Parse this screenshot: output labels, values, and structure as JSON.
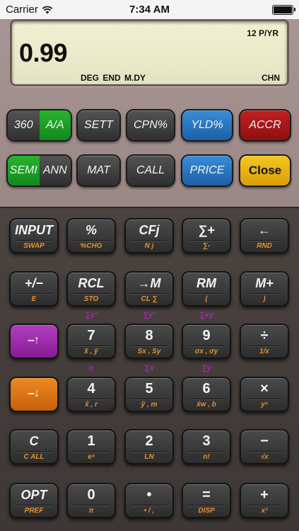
{
  "status": {
    "carrier": "Carrier",
    "time": "7:34 AM"
  },
  "display": {
    "mode": "12 P/YR",
    "value": "0.99",
    "flags": "DEG  END  M.DY",
    "right_flag": "CHN"
  },
  "function_rows": [
    [
      {
        "type": "split",
        "left": "360",
        "right": "A/A",
        "active": "right"
      },
      {
        "label": "SETT",
        "color": "dark"
      },
      {
        "label": "CPN%",
        "color": "dark"
      },
      {
        "label": "YLD%",
        "color": "blue"
      },
      {
        "label": "ACCR",
        "color": "red"
      }
    ],
    [
      {
        "type": "split",
        "left": "SEMI",
        "right": "ANN",
        "active": "left"
      },
      {
        "label": "MAT",
        "color": "dark"
      },
      {
        "label": "CALL",
        "color": "dark"
      },
      {
        "label": "PRICE",
        "color": "blue"
      },
      {
        "label": "Close",
        "color": "yellow"
      }
    ]
  ],
  "keys": [
    [
      {
        "main": "INPUT",
        "sub": "SWAP"
      },
      {
        "main": "%",
        "sub": "%CHG"
      },
      {
        "main": "CFj",
        "sub": "N j"
      },
      {
        "main": "∑+",
        "sub": "∑-"
      },
      {
        "main": "←",
        "sub": "RND"
      }
    ],
    [
      {
        "main": "+/−",
        "sub": "E"
      },
      {
        "main": "RCL",
        "sub": "STO"
      },
      {
        "main": "→M",
        "sub": "CL ∑"
      },
      {
        "main": "RM",
        "sub": "("
      },
      {
        "main": "M+",
        "sub": ")"
      }
    ],
    [
      {
        "main": "",
        "shift": "up",
        "color": "purple"
      },
      {
        "main": "7",
        "sub": "x̄ , ȳ",
        "above": "∑x²"
      },
      {
        "main": "8",
        "sub": "Sx , Sy",
        "above": "∑y²"
      },
      {
        "main": "9",
        "sub": "σx , σy",
        "above": "∑xy"
      },
      {
        "main": "÷",
        "sub": "1/x"
      }
    ],
    [
      {
        "main": "",
        "shift": "down",
        "color": "orange"
      },
      {
        "main": "4",
        "sub": "x̂ , r",
        "above": "n"
      },
      {
        "main": "5",
        "sub": "ŷ , m",
        "above": "∑x"
      },
      {
        "main": "6",
        "sub": "x̄w , b",
        "above": "∑y"
      },
      {
        "main": "×",
        "sub": "yˣ"
      }
    ],
    [
      {
        "main": "C",
        "sub": "C ALL"
      },
      {
        "main": "1",
        "sub": "eˣ"
      },
      {
        "main": "2",
        "sub": "LN"
      },
      {
        "main": "3",
        "sub": "n!"
      },
      {
        "main": "−",
        "sub": "√x"
      }
    ],
    [
      {
        "main": "OPT",
        "sub": "PREF"
      },
      {
        "main": "0",
        "sub": "π"
      },
      {
        "main": "•",
        "sub": "• / ,"
      },
      {
        "main": "=",
        "sub": "DISP"
      },
      {
        "main": "+",
        "sub": "x²"
      }
    ]
  ]
}
